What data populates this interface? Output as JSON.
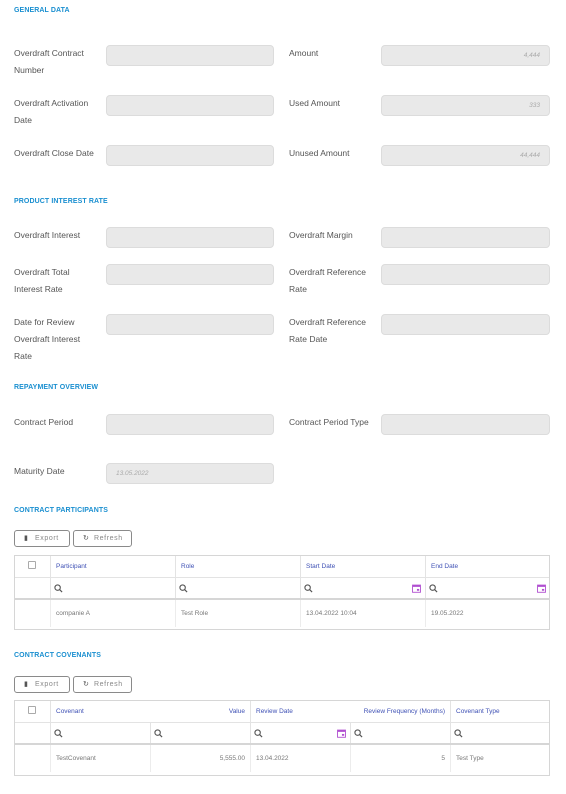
{
  "sections": {
    "general": "GENERAL DATA",
    "interest": "PRODUCT INTEREST RATE",
    "repayment": "REPAYMENT OVERVIEW",
    "participants": "CONTRACT PARTICIPANTS",
    "covenants": "CONTRACT COVENANTS"
  },
  "general": {
    "contract_number_label": "Overdraft Contract Number",
    "contract_number_value": "",
    "amount_label": "Amount",
    "amount_value": "4,444",
    "activation_label": "Overdraft Activation Date",
    "activation_value": "",
    "used_label": "Used Amount",
    "used_value": "333",
    "close_label": "Overdraft Close Date",
    "close_value": "",
    "unused_label": "Unused Amount",
    "unused_value": "44,444"
  },
  "interest": {
    "od_interest_label": "Overdraft Interest",
    "od_margin_label": "Overdraft Margin",
    "total_rate_label": "Overdraft Total Interest Rate",
    "reference_rate_label": "Overdraft Reference Rate",
    "review_date_label": "Date for Review Overdraft Interest Rate",
    "reference_rate_date_label": "Overdraft Reference Rate Date"
  },
  "repayment": {
    "contract_period_label": "Contract Period",
    "contract_period_type_label": "Contract Period Type",
    "maturity_label": "Maturity Date",
    "maturity_value": "13.05.2022"
  },
  "toolbar": {
    "export": "Export",
    "refresh": "Refresh"
  },
  "participants": {
    "columns": [
      "Participant",
      "Role",
      "Start Date",
      "End Date"
    ],
    "rows": [
      [
        "companie A",
        "Test Role",
        "13.04.2022 10:04",
        "19.05.2022"
      ]
    ]
  },
  "covenants": {
    "columns": [
      "Covenant",
      "Value",
      "Review Date",
      "Review Frequency (Months)",
      "Covenant Type"
    ],
    "rows": [
      [
        "TestCovenant",
        "5,555.00",
        "13.04.2022",
        "5",
        "Test Type"
      ]
    ]
  },
  "colors": {
    "section_title": "#1a8fd0",
    "grid_header": "#3f51b5",
    "calendar_icon": "#b04fd0"
  },
  "icons": [
    "file-icon",
    "refresh-icon",
    "search-icon",
    "calendar-icon",
    "checkbox"
  ]
}
